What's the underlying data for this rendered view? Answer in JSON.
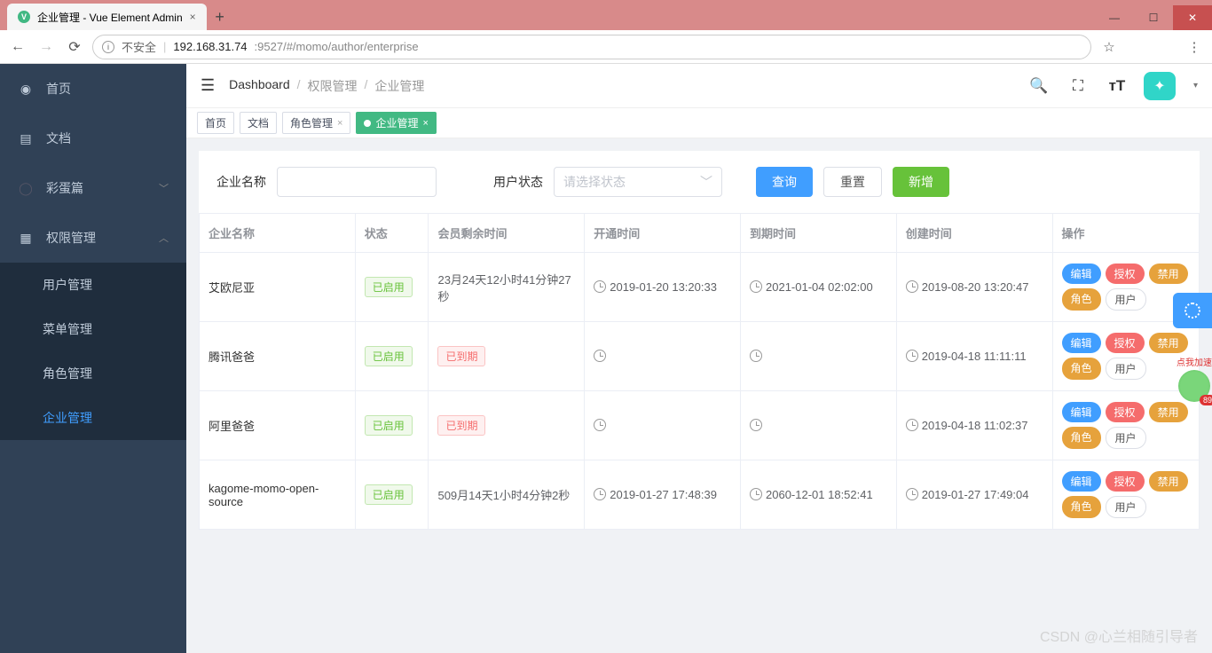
{
  "browser": {
    "tab_title": "企业管理 - Vue Element Admin",
    "url_insecure": "不安全",
    "url_ip": "192.168.31.74",
    "url_port_path": ":9527/#/momo/author/enterprise"
  },
  "sidebar": {
    "items": [
      {
        "label": "首页"
      },
      {
        "label": "文档"
      },
      {
        "label": "彩蛋篇"
      },
      {
        "label": "权限管理"
      }
    ],
    "sub_items": [
      {
        "label": "用户管理"
      },
      {
        "label": "菜单管理"
      },
      {
        "label": "角色管理"
      },
      {
        "label": "企业管理"
      }
    ]
  },
  "breadcrumb": {
    "a": "Dashboard",
    "b": "权限管理",
    "c": "企业管理"
  },
  "tags": {
    "a": "首页",
    "b": "文档",
    "c": "角色管理",
    "d": "企业管理"
  },
  "search": {
    "name_label": "企业名称",
    "status_label": "用户状态",
    "status_placeholder": "请选择状态",
    "query_btn": "查询",
    "reset_btn": "重置",
    "add_btn": "新增"
  },
  "table": {
    "headers": {
      "name": "企业名称",
      "status": "状态",
      "remain": "会员剩余时间",
      "open": "开通时间",
      "expire": "到期时间",
      "create": "创建时间",
      "ops": "操作"
    },
    "status_enabled": "已启用",
    "expired_label": "已到期",
    "ops": {
      "edit": "编辑",
      "auth": "授权",
      "disable": "禁用",
      "role": "角色",
      "user": "用户"
    },
    "rows": [
      {
        "name": "艾欧尼亚",
        "remain": "23月24天12小时41分钟27秒",
        "open": "2019-01-20 13:20:33",
        "expire": "2021-01-04 02:02:00",
        "create": "2019-08-20 13:20:47",
        "expired": false
      },
      {
        "name": "腾讯爸爸",
        "remain": "",
        "open": "",
        "expire": "",
        "create": "2019-04-18 11:11:11",
        "expired": true
      },
      {
        "name": "阿里爸爸",
        "remain": "",
        "open": "",
        "expire": "",
        "create": "2019-04-18 11:02:37",
        "expired": true
      },
      {
        "name": "kagome-momo-open-source",
        "remain": "509月14天1小时4分钟2秒",
        "open": "2019-01-27 17:48:39",
        "expire": "2060-12-01 18:52:41",
        "create": "2019-01-27 17:49:04",
        "expired": false
      }
    ]
  },
  "speed_widget": {
    "label": "点我加速",
    "badge": "89"
  },
  "watermark": "CSDN @心兰相随引导者"
}
